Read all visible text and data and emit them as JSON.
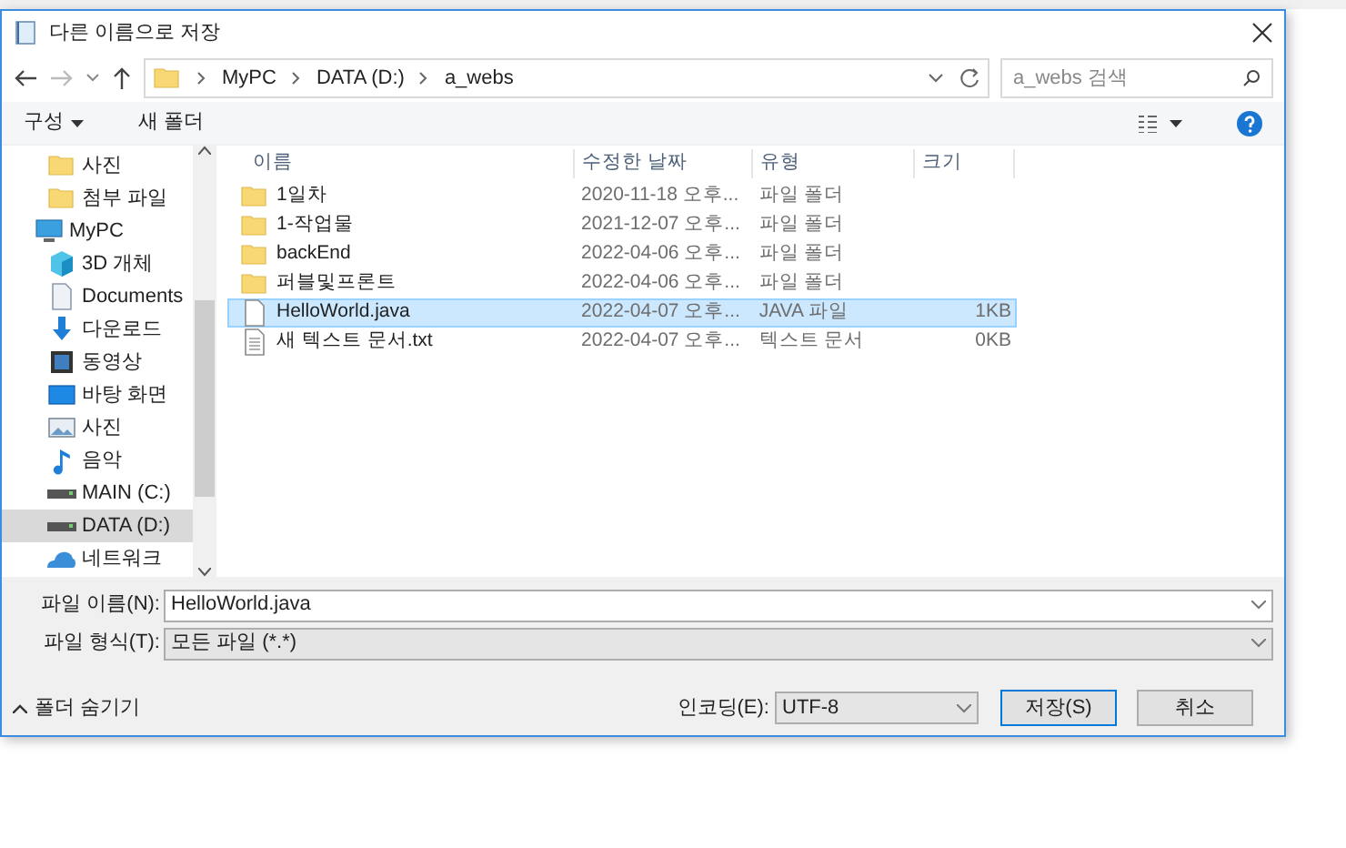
{
  "window": {
    "title": "다른 이름으로 저장"
  },
  "address": {
    "crumbs": [
      "MyPC",
      "DATA (D:)",
      "a_webs"
    ],
    "search_placeholder": "a_webs 검색"
  },
  "toolbar": {
    "organize": "구성",
    "new_folder": "새 폴더"
  },
  "sidebar": {
    "items": [
      {
        "label": "사진",
        "kind": "folder",
        "selected": false
      },
      {
        "label": "첨부 파일",
        "kind": "folder",
        "selected": false
      },
      {
        "label": "MyPC",
        "kind": "pc",
        "selected": false,
        "children": [
          {
            "label": "3D 개체",
            "kind": "cube",
            "selected": false
          },
          {
            "label": "Documents",
            "kind": "doc",
            "selected": false
          },
          {
            "label": "다운로드",
            "kind": "download",
            "selected": false
          },
          {
            "label": "동영상",
            "kind": "video",
            "selected": false
          },
          {
            "label": "바탕 화면",
            "kind": "desktop",
            "selected": false
          },
          {
            "label": "사진",
            "kind": "picture",
            "selected": false
          },
          {
            "label": "음악",
            "kind": "music",
            "selected": false
          },
          {
            "label": "MAIN (C:)",
            "kind": "drive",
            "selected": false
          },
          {
            "label": "DATA (D:)",
            "kind": "drive",
            "selected": true
          }
        ]
      },
      {
        "label": "네트워크",
        "kind": "network",
        "selected": false
      }
    ]
  },
  "table": {
    "columns": [
      "이름",
      "수정한 날짜",
      "유형",
      "크기"
    ],
    "rows": [
      {
        "kind": "folder",
        "name": "1일차",
        "date": "2020-11-18 오후...",
        "type": "파일 폴더",
        "size": "",
        "selected": false
      },
      {
        "kind": "folder",
        "name": "1-작업물",
        "date": "2021-12-07 오후...",
        "type": "파일 폴더",
        "size": "",
        "selected": false
      },
      {
        "kind": "folder",
        "name": "backEnd",
        "date": "2022-04-06 오후...",
        "type": "파일 폴더",
        "size": "",
        "selected": false
      },
      {
        "kind": "folder",
        "name": "퍼블및프론트",
        "date": "2022-04-06 오후...",
        "type": "파일 폴더",
        "size": "",
        "selected": false
      },
      {
        "kind": "file",
        "name": "HelloWorld.java",
        "date": "2022-04-07 오후...",
        "type": "JAVA 파일",
        "size": "1KB",
        "selected": true
      },
      {
        "kind": "text",
        "name": "새 텍스트 문서.txt",
        "date": "2022-04-07 오후...",
        "type": "텍스트 문서",
        "size": "0KB",
        "selected": false
      }
    ]
  },
  "form": {
    "filename_label": "파일 이름(N):",
    "filename": "HelloWorld.java",
    "filetype_label": "파일 형식(T):",
    "filetype": "모든 파일 (*.*)"
  },
  "footer": {
    "hide_folders": "폴더 숨기기",
    "encoding_label": "인코딩(E):",
    "encoding": "UTF-8",
    "save": "저장(S)",
    "cancel": "취소"
  }
}
